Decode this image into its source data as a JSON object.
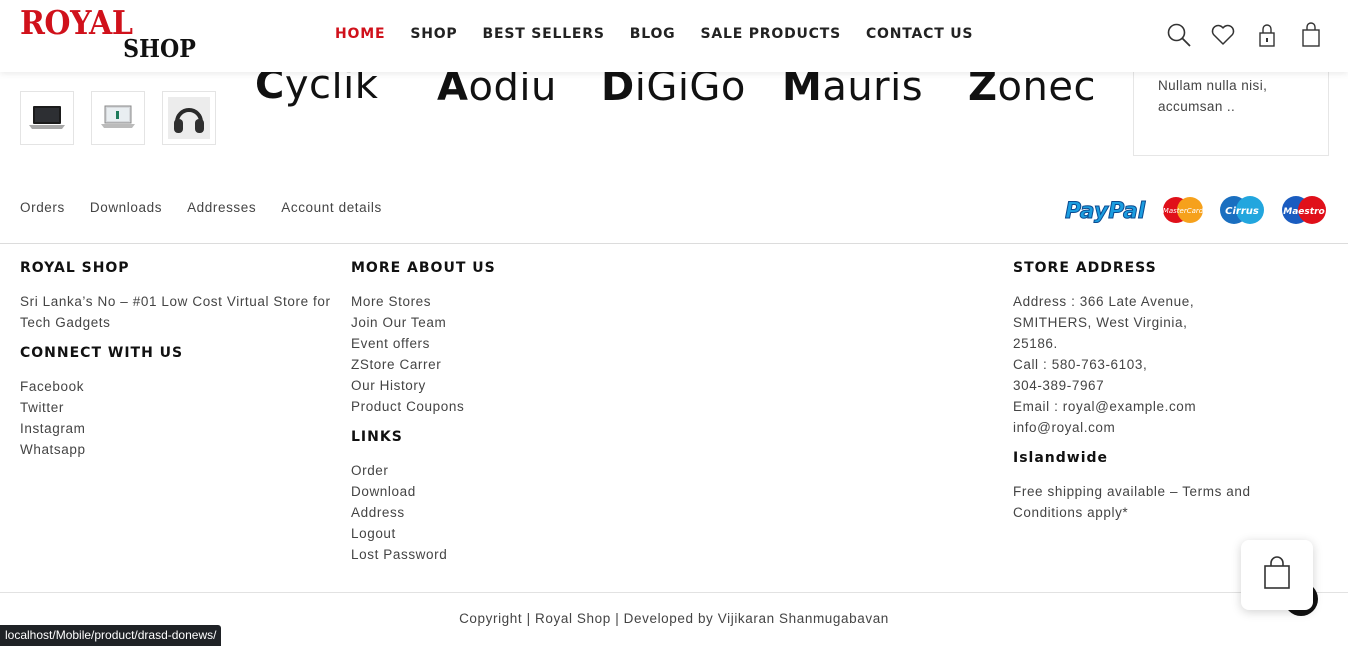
{
  "header": {
    "logo_top": "ROYAL",
    "logo_bottom": "SHOP",
    "nav": [
      {
        "label": "HOME"
      },
      {
        "label": "SHOP"
      },
      {
        "label": "BEST SELLERS"
      },
      {
        "label": "BLOG"
      },
      {
        "label": "SALE PRODUCTS"
      },
      {
        "label": "CONTACT US"
      }
    ],
    "icons": [
      "search-icon",
      "heart-icon",
      "lock-icon",
      "shopping-bag-icon"
    ]
  },
  "thumbnails": [
    "laptop-thumbnail",
    "laptop-stand-thumbnail",
    "headphones-thumbnail"
  ],
  "brands": [
    {
      "initial": "C",
      "rest": "yclik"
    },
    {
      "initial": "A",
      "rest": "odiu"
    },
    {
      "initial": "D",
      "rest": "iGiGo"
    },
    {
      "initial": "M",
      "rest": "auris"
    },
    {
      "initial": "Z",
      "rest": "onec"
    }
  ],
  "side_card": {
    "text": "Nullam nulla nisi, accumsan .."
  },
  "account_links": [
    {
      "label": "Orders"
    },
    {
      "label": "Downloads"
    },
    {
      "label": "Addresses"
    },
    {
      "label": "Account details"
    }
  ],
  "payments": {
    "paypal": "PayPal",
    "mastercard": "MasterCard",
    "cirrus": "Cirrus",
    "maestro": "Maestro"
  },
  "footer": {
    "royal_shop": {
      "heading": "ROYAL SHOP",
      "text": "Sri Lanka’s No – #01 Low Cost Virtual Store for Tech Gadgets"
    },
    "connect": {
      "heading": "CONNECT WITH US",
      "links": [
        "Facebook",
        "Twitter",
        "Instagram",
        "Whatsapp"
      ]
    },
    "more_about": {
      "heading": "MORE ABOUT US",
      "links": [
        "More Stores",
        "Join Our Team",
        "Event offers",
        "ZStore Carrer",
        "Our History",
        "Product Coupons"
      ]
    },
    "links": {
      "heading": "LINKS",
      "links": [
        "Order",
        "Download",
        "Address",
        "Logout",
        "Lost Password"
      ]
    },
    "store_address": {
      "heading": "STORE ADDRESS",
      "lines": [
        "Address : 366 Late Avenue,",
        "SMITHERS, West Virginia,",
        "25186.",
        "Call : 580-763-6103,",
        "304-389-7967",
        "Email : royal@example.com",
        "info@royal.com"
      ]
    },
    "islandwide": {
      "heading": "Islandwide",
      "text": "Free shipping available – Terms and Conditions apply*"
    }
  },
  "copyright": "Copyright | Royal Shop | Developed by Vijikaran Shanmugabavan",
  "status_url": "localhost/Mobile/product/drasd-donews/",
  "colors": {
    "accent": "#d0111b",
    "text": "#444444",
    "heading": "#111111"
  }
}
